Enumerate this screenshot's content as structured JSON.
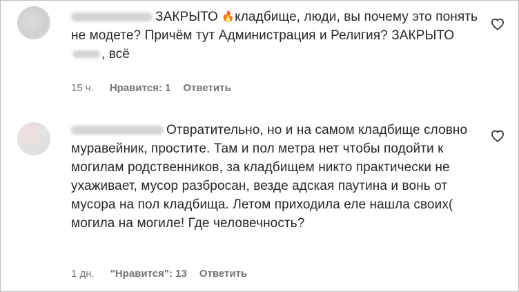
{
  "comments": [
    {
      "text_part1": "ЗАКРЫТО",
      "emoji": "🔥",
      "text_part2": "кладбище, люди, вы почему это понять не модете? Причём тут Администрация и Религия? ЗАКРЫТО",
      "text_part3": ", всё",
      "time": "15 ч.",
      "likes": "Нравится: 1",
      "reply": "Ответить"
    },
    {
      "text": "Отвратительно, но и на самом кладбище словно муравейник, простите. Там и пол метра нет чтобы подойти к могилам родственников, за кладбищем никто практически не ухаживает, мусор разбросан, везде адская паутина и вонь от мусора на пол кладбища. Летом приходила еле нашла своих( могила на могиле! Где человечность?",
      "time": "1 дн.",
      "likes": "\"Нравится\": 13",
      "reply": "Ответить"
    }
  ],
  "icons": {
    "like": "heart-outline-icon"
  }
}
